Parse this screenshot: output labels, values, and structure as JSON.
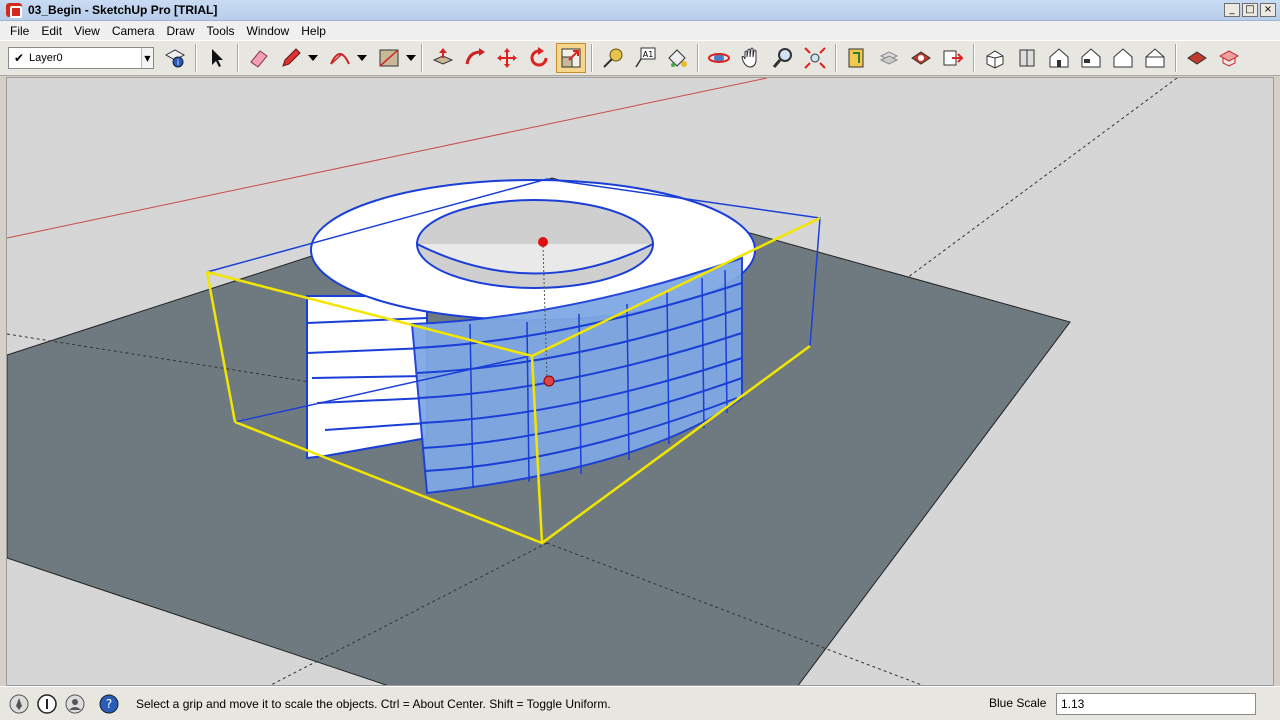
{
  "window": {
    "title": "03_Begin - SketchUp Pro [TRIAL]",
    "min_glyph": "_",
    "max_glyph": "□",
    "close_glyph": "×"
  },
  "menu": [
    "File",
    "Edit",
    "View",
    "Camera",
    "Draw",
    "Tools",
    "Window",
    "Help"
  ],
  "toolbar": {
    "layer_checked": "✔",
    "layer_name": "Layer0",
    "layer_dropdown_glyph": "▼",
    "tools": [
      "layer-manager-icon",
      "select-icon",
      "eraser-icon",
      "pencil-icon",
      "arc-icon",
      "rectangle-icon",
      "push-pull-icon",
      "follow-me-icon",
      "move-icon",
      "rotate-icon",
      "scale-icon",
      "tape-measure-icon",
      "text-icon",
      "paint-bucket-icon",
      "orbit-icon",
      "pan-icon",
      "zoom-icon",
      "zoom-extents-icon",
      "section-plane-icon",
      "components-icon",
      "materials-icon",
      "export-icon",
      "iso-view-icon",
      "top-view-icon",
      "front-view-icon",
      "right-view-icon",
      "back-view-icon",
      "left-view-icon",
      "get-models-icon",
      "share-model-icon"
    ],
    "active_tool": "scale-icon"
  },
  "colors": {
    "selection": "#1a3fd6",
    "bounding_box": "#f2e600",
    "ground": "#6f7a80",
    "sky": "#d6d6d6",
    "glass": "#7fa8e4"
  },
  "status": {
    "hint": "Select a grip and move it to scale the objects. Ctrl = About Center. Shift = Toggle Uniform.",
    "vcb_label": "Blue Scale",
    "vcb_value": "1.13",
    "icons": [
      "geo-location-icon",
      "credits-icon",
      "user-account-icon",
      "help-icon"
    ]
  }
}
